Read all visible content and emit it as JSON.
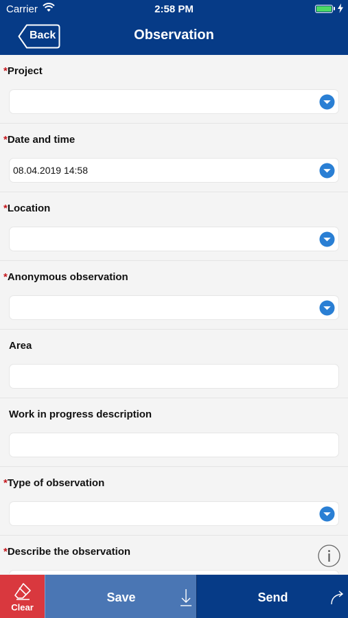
{
  "status_bar": {
    "carrier": "Carrier",
    "time": "2:58 PM",
    "battery_level": 1.0,
    "battery_color": "#4cd964"
  },
  "nav": {
    "back_label": "Back",
    "title": "Observation"
  },
  "colors": {
    "brand_blue": "#063b87",
    "save_blue": "#4a76b4",
    "clear_red": "#d9383e",
    "required_red": "#c4161c",
    "dropdown_blue": "#2a7fd4"
  },
  "fields": [
    {
      "label": "Project",
      "required": "*",
      "type": "dropdown",
      "value": "",
      "icon": "chevron-down-circle-icon"
    },
    {
      "label": "Date and time",
      "required": "*",
      "type": "dropdown",
      "value": "08.04.2019 14:58",
      "icon": "chevron-down-circle-icon"
    },
    {
      "label": "Location",
      "required": "*",
      "type": "dropdown",
      "value": "",
      "icon": "chevron-down-circle-icon"
    },
    {
      "label": "Anonymous observation",
      "required": "*",
      "type": "dropdown",
      "value": "",
      "icon": "chevron-down-circle-icon"
    },
    {
      "label": "Area",
      "required": "",
      "type": "text",
      "value": ""
    },
    {
      "label": "Work in progress description",
      "required": "",
      "type": "text",
      "value": ""
    },
    {
      "label": "Type of observation",
      "required": "*",
      "type": "dropdown",
      "value": "",
      "icon": "chevron-down-circle-icon"
    },
    {
      "label": "Describe the observation",
      "required": "*",
      "type": "text",
      "value": "",
      "icon": "info-icon"
    }
  ],
  "bottom_bar": {
    "clear_label": "Clear",
    "save_label": "Save",
    "send_label": "Send"
  }
}
